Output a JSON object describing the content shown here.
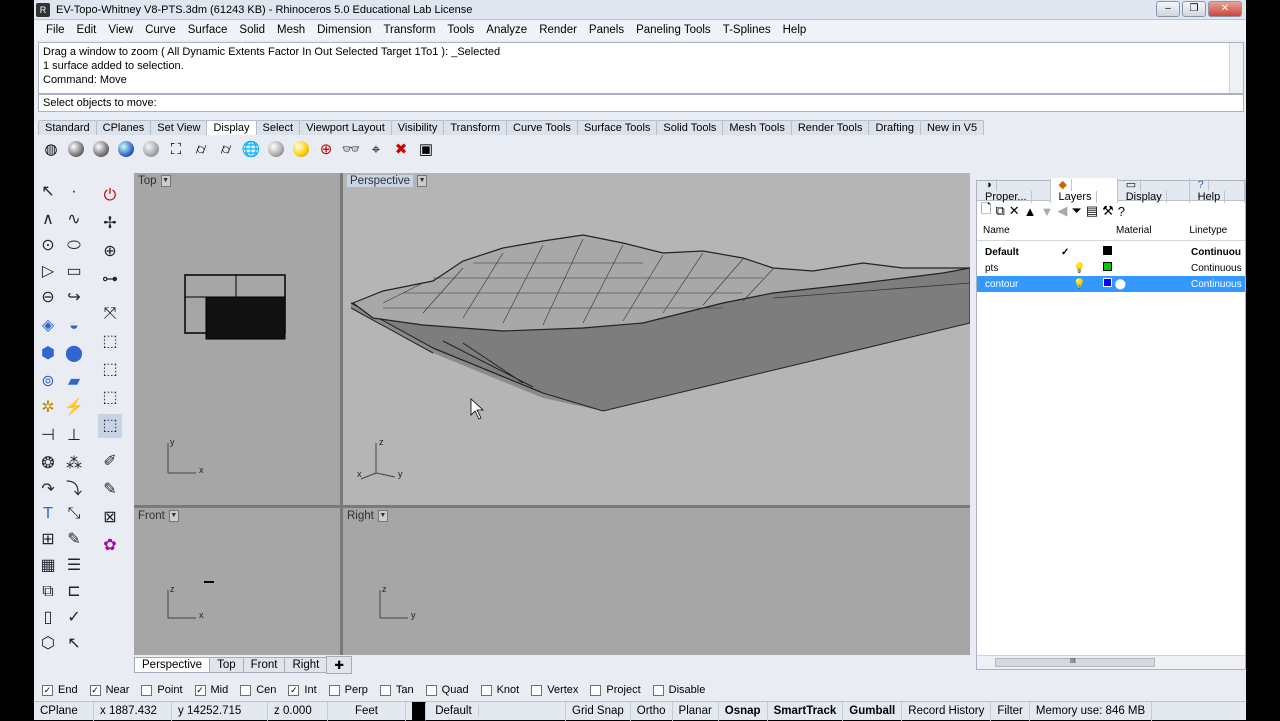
{
  "window": {
    "title": "EV-Topo-Whitney V8-PTS.3dm (61243 KB) - Rhinoceros 5.0 Educational Lab License"
  },
  "menu": [
    "File",
    "Edit",
    "View",
    "Curve",
    "Surface",
    "Solid",
    "Mesh",
    "Dimension",
    "Transform",
    "Tools",
    "Analyze",
    "Render",
    "Panels",
    "Paneling Tools",
    "T-Splines",
    "Help"
  ],
  "command_history": [
    "Drag a window to zoom ( All  Dynamic  Extents  Factor  In  Out  Selected  Target  1To1 ): _Selected",
    "1 surface added to selection.",
    "Command: Move"
  ],
  "command_prompt": "Select objects to move:",
  "toolbar_tabs": [
    "Standard",
    "CPlanes",
    "Set View",
    "Display",
    "Select",
    "Viewport Layout",
    "Visibility",
    "Transform",
    "Curve Tools",
    "Surface Tools",
    "Solid Tools",
    "Mesh Tools",
    "Render Tools",
    "Drafting",
    "New in V5"
  ],
  "active_toolbar_tab": "Display",
  "viewports": {
    "top": "Top",
    "perspective": "Perspective",
    "front": "Front",
    "right": "Right"
  },
  "viewport_tabs": [
    "Perspective",
    "Top",
    "Front",
    "Right"
  ],
  "panel": {
    "tabs": [
      "Proper...",
      "Layers",
      "Display",
      "Help"
    ],
    "columns": {
      "name": "Name",
      "material": "Material",
      "linetype": "Linetype"
    },
    "layers": [
      {
        "name": "Default",
        "check": "✓",
        "color": "#000000",
        "linetype": "Continuou"
      },
      {
        "name": "pts",
        "check": "",
        "color": "#00cc00",
        "linetype": "Continuous"
      },
      {
        "name": "contour",
        "check": "",
        "color": "#0000ff",
        "linetype": "Continuous"
      }
    ],
    "scroll_mark": "III"
  },
  "osnaps": [
    {
      "label": "End",
      "checked": true
    },
    {
      "label": "Near",
      "checked": true
    },
    {
      "label": "Point",
      "checked": false
    },
    {
      "label": "Mid",
      "checked": true
    },
    {
      "label": "Cen",
      "checked": false
    },
    {
      "label": "Int",
      "checked": true
    },
    {
      "label": "Perp",
      "checked": false
    },
    {
      "label": "Tan",
      "checked": false
    },
    {
      "label": "Quad",
      "checked": false
    },
    {
      "label": "Knot",
      "checked": false
    },
    {
      "label": "Vertex",
      "checked": false
    },
    {
      "label": "Project",
      "checked": false
    },
    {
      "label": "Disable",
      "checked": false
    }
  ],
  "status": {
    "cplane": "CPlane",
    "x": "x 1887.432",
    "y": "y 14252.715",
    "z": "z 0.000",
    "units": "Feet",
    "layer": "Default",
    "grid_snap": "Grid Snap",
    "ortho": "Ortho",
    "planar": "Planar",
    "osnap": "Osnap",
    "smarttrack": "SmartTrack",
    "gumball": "Gumball",
    "record_history": "Record History",
    "filter": "Filter",
    "memory": "Memory use: 846 MB"
  },
  "axes": {
    "x": "x",
    "y": "y",
    "z": "z"
  }
}
